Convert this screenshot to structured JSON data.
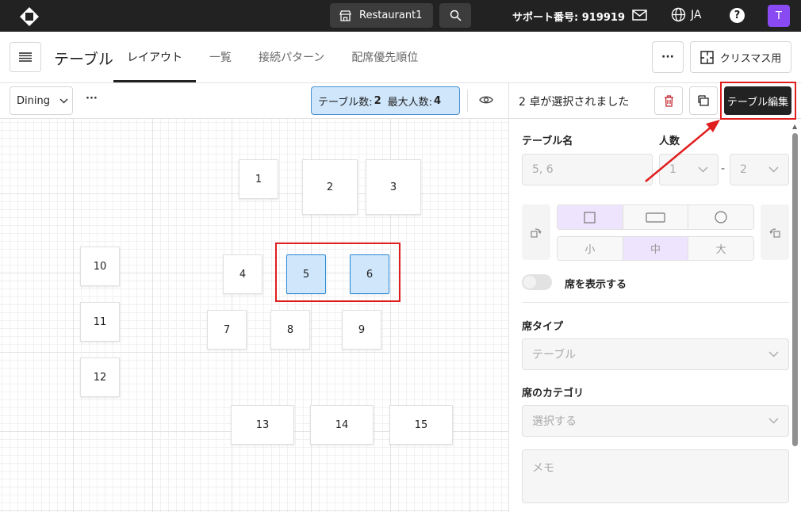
{
  "topbar": {
    "restaurant": "Restaurant1",
    "support": "サポート番号: 919919",
    "language": "JA",
    "avatar_initial": "T"
  },
  "header": {
    "title": "テーブル",
    "tabs": [
      {
        "label": "レイアウト",
        "active": true
      },
      {
        "label": "一覧",
        "active": false
      },
      {
        "label": "接続パターン",
        "active": false
      },
      {
        "label": "配席優先順位",
        "active": false
      }
    ],
    "more_label": "···",
    "layout_name": "クリスマス用"
  },
  "toolbar": {
    "area": "Dining",
    "more_label": "···",
    "table_count_label": "テーブル数:",
    "table_count": "2",
    "max_people_label": "最大人数:",
    "max_people": "4"
  },
  "tables": [
    {
      "id": "1",
      "selected": false
    },
    {
      "id": "2",
      "selected": false
    },
    {
      "id": "3",
      "selected": false
    },
    {
      "id": "4",
      "selected": false
    },
    {
      "id": "5",
      "selected": true
    },
    {
      "id": "6",
      "selected": true
    },
    {
      "id": "7",
      "selected": false
    },
    {
      "id": "8",
      "selected": false
    },
    {
      "id": "9",
      "selected": false
    },
    {
      "id": "10",
      "selected": false
    },
    {
      "id": "11",
      "selected": false
    },
    {
      "id": "12",
      "selected": false
    },
    {
      "id": "13",
      "selected": false
    },
    {
      "id": "14",
      "selected": false
    },
    {
      "id": "15",
      "selected": false
    }
  ],
  "panel": {
    "selected_text": "2 卓が選択されました",
    "edit_button": "テーブル編集",
    "table_name_label": "テーブル名",
    "table_name_value": "5, 6",
    "people_label": "人数",
    "people_min": "1",
    "people_separator": "-",
    "people_max": "2",
    "shapes": [
      "square",
      "rectangle",
      "circle"
    ],
    "selected_shape": "square",
    "sizes": [
      "小",
      "中",
      "大"
    ],
    "selected_size": "中",
    "show_seats_label": "席を表示する",
    "show_seats": false,
    "seat_type_label": "席タイプ",
    "seat_type_value": "テーブル",
    "seat_category_label": "席のカテゴリ",
    "seat_category_placeholder": "選択する",
    "memo_placeholder": "メモ"
  },
  "colors": {
    "topbar": "#222222",
    "selected_table": "#cfe6fb",
    "selected_border": "#2a8ad8",
    "annotation": "#e01e1e",
    "segment_active": "#efe4fd",
    "avatar": "#8a4af3"
  }
}
